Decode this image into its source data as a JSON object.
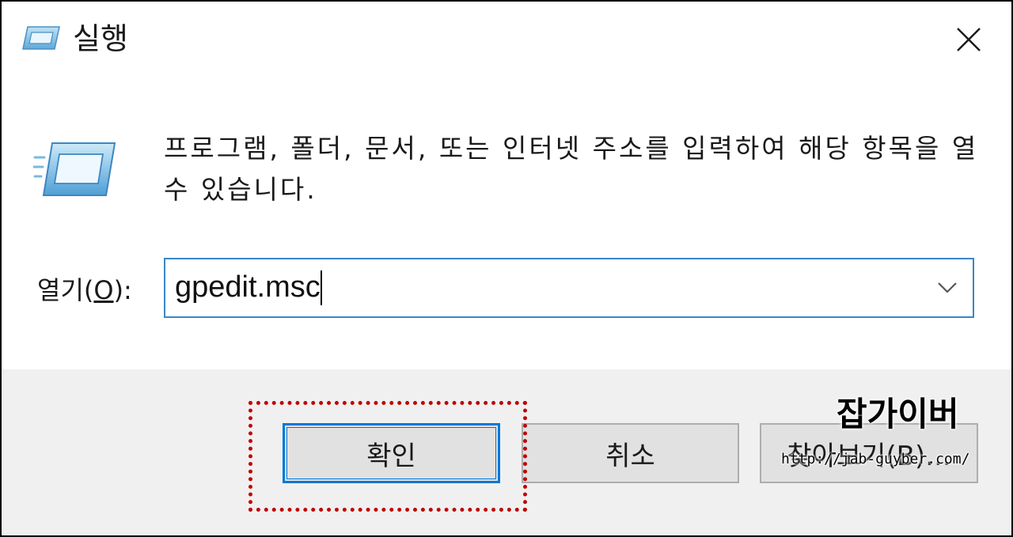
{
  "window": {
    "title": "실행",
    "icon": "run-icon",
    "close_icon": "close-icon"
  },
  "description": "프로그램, 폴더, 문서, 또는 인터넷 주소를 입력하여 해당 항목을 열 수 있습니다.",
  "open_field": {
    "label_prefix": "열기(",
    "label_mnemonic": "O",
    "label_suffix": "):",
    "value": "gpedit.msc",
    "dropdown_icon": "chevron-down-icon"
  },
  "buttons": {
    "ok": "확인",
    "cancel": "취소",
    "browse": "찾아보기(B)..."
  },
  "watermark": {
    "name": "잡가이버",
    "url": "http://jab-guyber.com/"
  },
  "colors": {
    "accent": "#0078d7",
    "highlight": "#c00000",
    "footer_bg": "#f0f0f0",
    "input_border": "#3a86c8"
  }
}
